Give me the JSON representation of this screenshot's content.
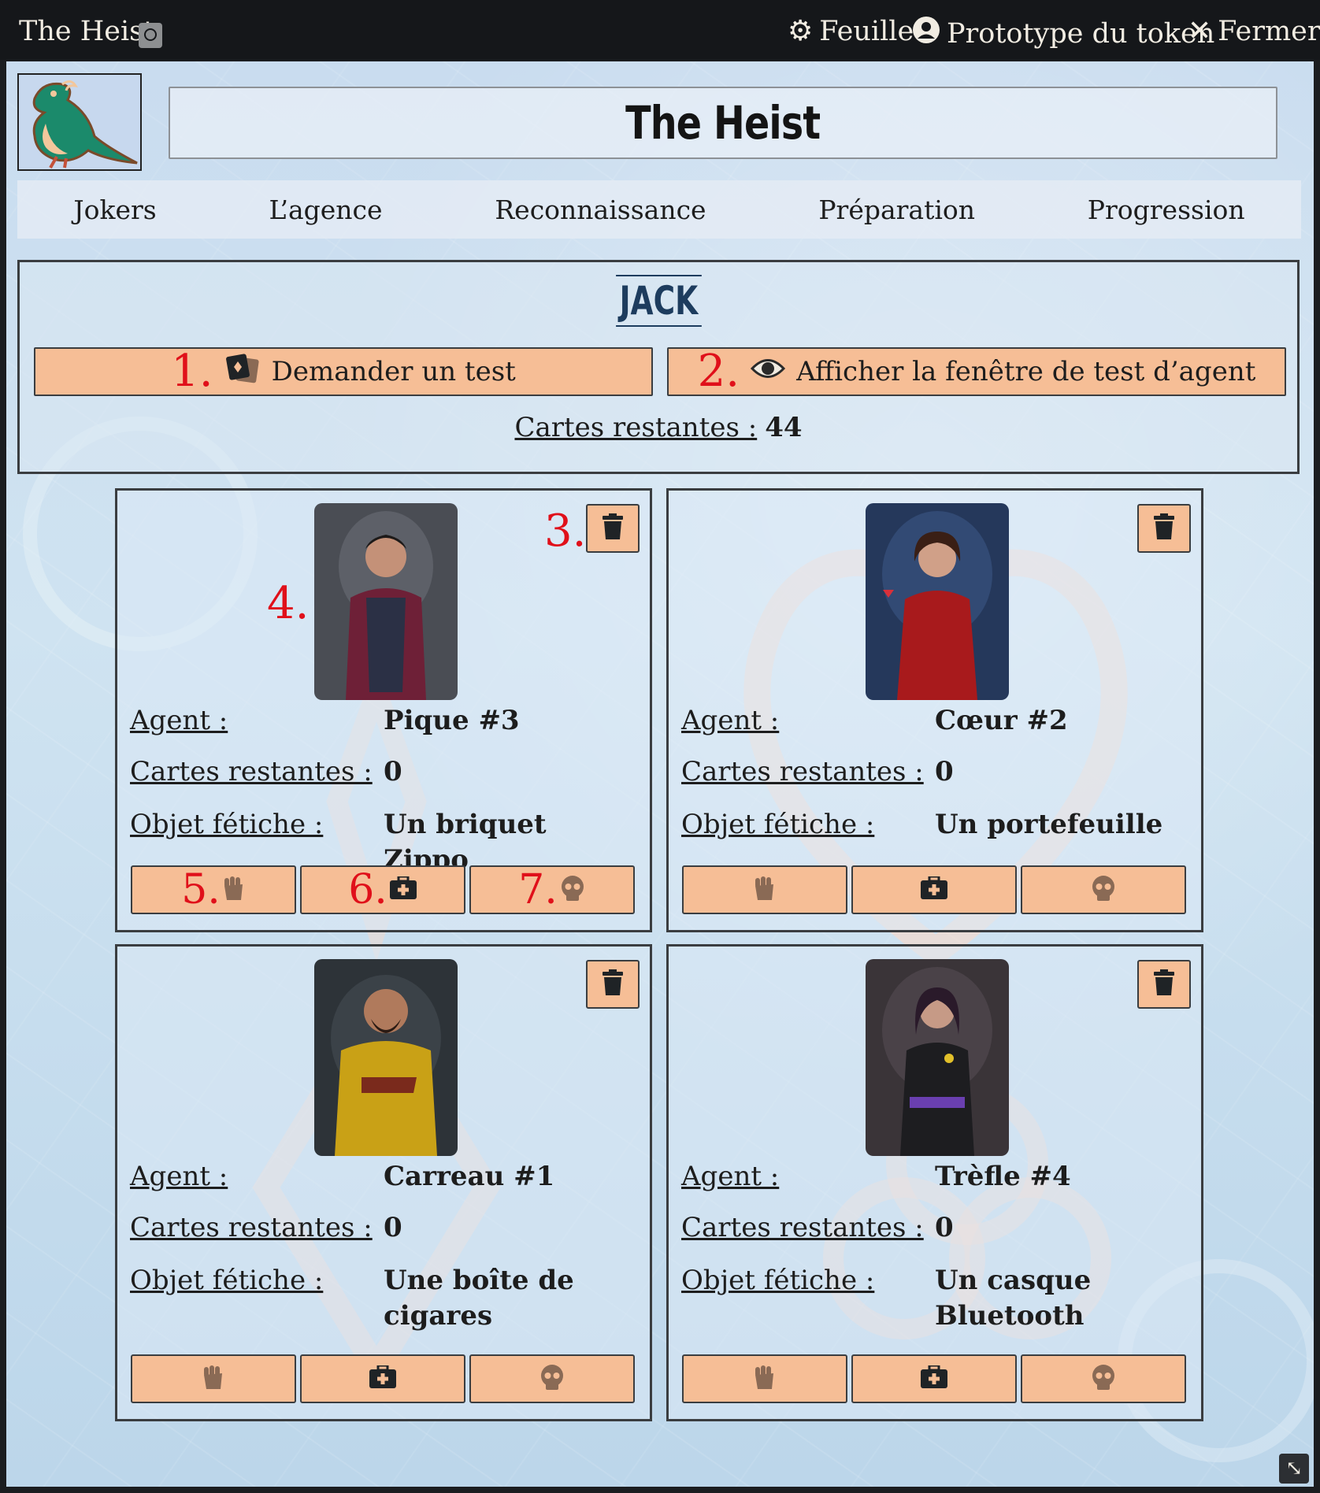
{
  "window": {
    "title": "The Heist",
    "controls": {
      "sheet": "Feuille",
      "prototype": "Prototype du token",
      "close": "Fermer"
    }
  },
  "actor": {
    "name": "The Heist"
  },
  "tabs": [
    "Jokers",
    "L’agence",
    "Reconnaissance",
    "Préparation",
    "Progression"
  ],
  "jack": {
    "title": "JACK",
    "request_test": "Demander un test",
    "show_window": "Afficher la fenêtre de test d’agent",
    "remaining_label": "Cartes restantes :",
    "remaining_value": "44"
  },
  "labels": {
    "agent": "Agent :",
    "remaining": "Cartes restantes :",
    "fetish": "Objet fétiche :"
  },
  "annotations": [
    "1.",
    "2.",
    "3.",
    "4.",
    "5.",
    "6.",
    "7."
  ],
  "agents": [
    {
      "agent": "Pique #3",
      "remaining": "0",
      "fetish": "Un briquet Zippo"
    },
    {
      "agent": "Cœur #2",
      "remaining": "0",
      "fetish": "Un portefeuille"
    },
    {
      "agent": "Carreau #1",
      "remaining": "0",
      "fetish": "Une boîte de cigares"
    },
    {
      "agent": "Trèfle #4",
      "remaining": "0",
      "fetish": "Un casque Bluetooth"
    }
  ],
  "icons": {
    "settings": "gear-icon",
    "prototype": "user-circle-icon",
    "close": "x-icon",
    "request": "cards-icon",
    "show": "eye-icon",
    "delete": "trash-icon",
    "action1": "fist-icon",
    "action2": "medkit-icon",
    "action3": "skull-icon"
  },
  "colors": {
    "button_fill": "#f6be96",
    "annotation": "#e0101a",
    "jack_title": "#1d3c5e"
  }
}
